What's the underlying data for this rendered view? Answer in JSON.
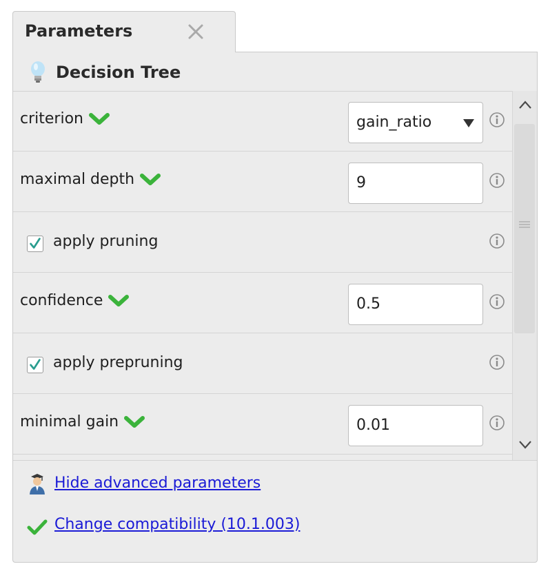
{
  "tab": {
    "title": "Parameters"
  },
  "operator": {
    "title": "Decision Tree"
  },
  "parameters": {
    "criterion": {
      "label": "criterion",
      "value": "gain_ratio"
    },
    "maximal_depth": {
      "label": "maximal depth",
      "value": "9"
    },
    "apply_pruning": {
      "label": "apply pruning",
      "checked": true
    },
    "confidence": {
      "label": "confidence",
      "value": "0.5"
    },
    "apply_prepruning": {
      "label": "apply prepruning",
      "checked": true
    },
    "minimal_gain": {
      "label": "minimal gain",
      "value": "0.01"
    }
  },
  "footer": {
    "advanced_link": "Hide advanced parameters",
    "compatibility_link": "Change compatibility (10.1.003)"
  },
  "colors": {
    "accent_green": "#3bb33b",
    "link_blue": "#1a1ad6",
    "panel_bg": "#ececec"
  },
  "icons": [
    "close-icon",
    "lightbulb-icon",
    "chevron-down-icon",
    "info-icon",
    "check-icon",
    "user-icon",
    "scroll-up-icon",
    "scroll-down-icon"
  ]
}
